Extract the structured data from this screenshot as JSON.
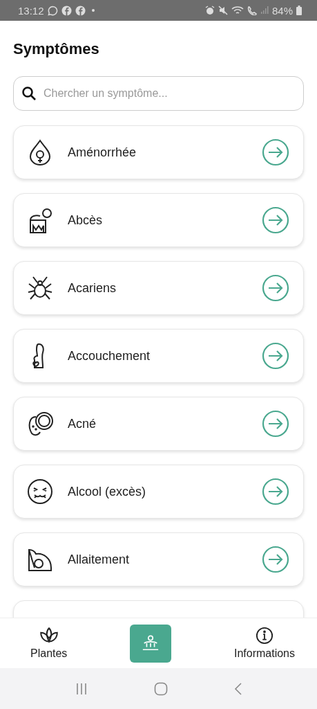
{
  "status_bar": {
    "time": "13:12",
    "battery": "84%"
  },
  "title": "Symptômes",
  "search": {
    "placeholder": "Chercher un symptôme..."
  },
  "symptoms": [
    {
      "kind": "item",
      "label": "Aménorrhée"
    },
    {
      "kind": "item",
      "label": "Abcès"
    },
    {
      "kind": "item",
      "label": "Acariens"
    },
    {
      "kind": "item",
      "label": "Accouchement"
    },
    {
      "kind": "item",
      "label": "Acné"
    },
    {
      "kind": "item",
      "label": "Alcool (excès)"
    },
    {
      "kind": "item",
      "label": "Allaitement"
    },
    {
      "kind": "partial"
    }
  ],
  "bottom_nav": [
    {
      "label": "Plantes",
      "selected": false
    },
    {
      "selected": true
    },
    {
      "label": "Informations",
      "selected": false
    }
  ]
}
